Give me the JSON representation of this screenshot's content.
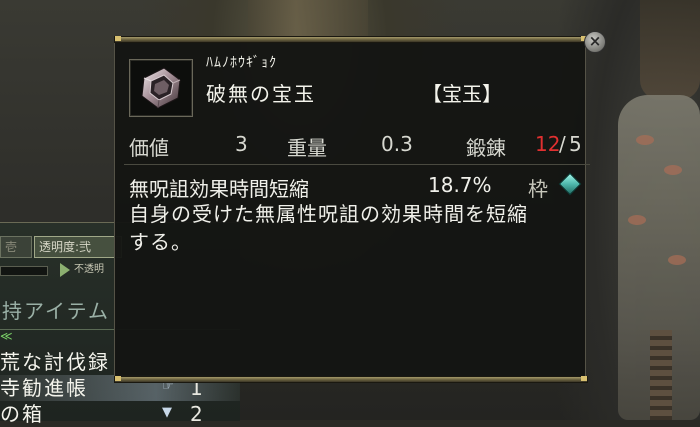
{
  "tooltip": {
    "item_reading": "ﾊﾑﾉﾎｳｷﾞｮｸ",
    "item_name": "破無の宝玉",
    "item_category": "【宝玉】",
    "stats": {
      "value_label": "価値",
      "value": "3",
      "weight_label": "重量",
      "weight": "0.3",
      "forge_label": "鍛錬",
      "forge_current": "12",
      "forge_sep": "/",
      "forge_max": "5"
    },
    "effect": {
      "name": "無呪詛効果時間短縮",
      "value": "18.7%",
      "slot_label": "枠",
      "slot_gem_color": "#4fb8ac"
    },
    "description_lines": [
      "自身の受けた無属性呪詛の効果時間を短縮",
      "する。"
    ],
    "close_icon": "close-icon"
  },
  "inventory": {
    "tab_left": "壱",
    "tab_active": "透明度:弐",
    "slider_label": "不透明",
    "title": "持アイテム",
    "category_mark": "≪",
    "rows": [
      {
        "name": "荒な討伐録",
        "qty": ""
      },
      {
        "name": "寺勧進帳",
        "qty": "1"
      },
      {
        "name": "の箱",
        "qty": "2"
      }
    ]
  }
}
